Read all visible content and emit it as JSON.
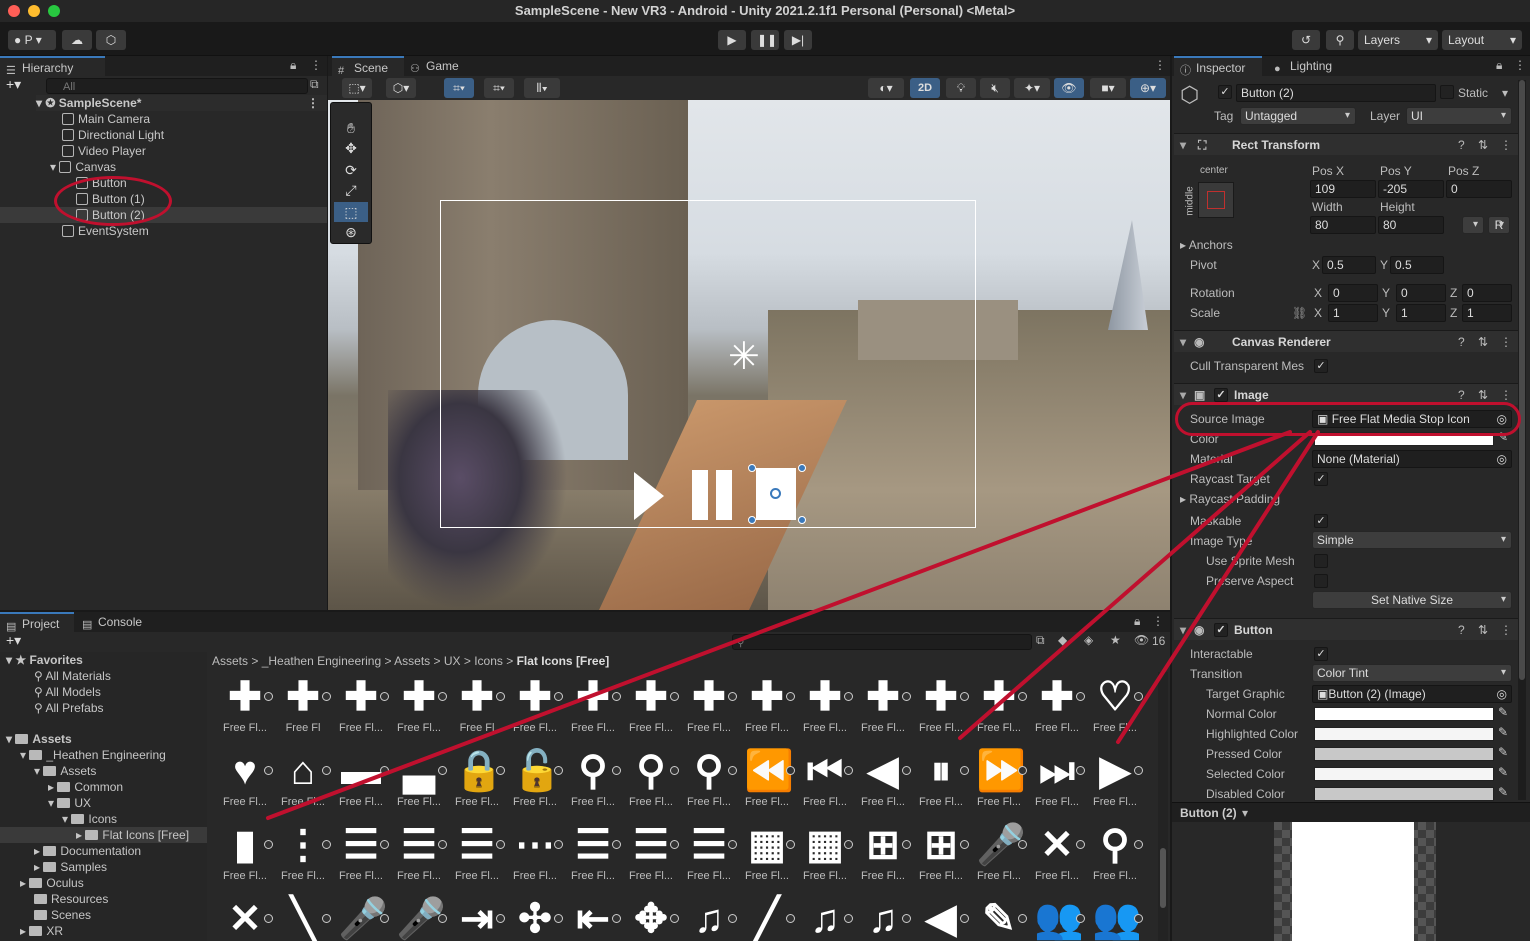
{
  "window": {
    "title": "SampleScene - New VR3 - Android - Unity 2021.2.1f1 Personal (Personal) <Metal>"
  },
  "toolbar": {
    "account_label": "P",
    "layers_label": "Layers",
    "layout_label": "Layout"
  },
  "hierarchy": {
    "tab_label": "Hierarchy",
    "search_placeholder": "All",
    "scene_name": "SampleScene*",
    "items": [
      {
        "label": "Main Camera"
      },
      {
        "label": "Directional Light"
      },
      {
        "label": "Video Player"
      },
      {
        "label": "Canvas"
      },
      {
        "label": "Button"
      },
      {
        "label": "Button (1)"
      },
      {
        "label": "Button (2)"
      },
      {
        "label": "EventSystem"
      }
    ]
  },
  "scene": {
    "tabs": [
      {
        "label": "Scene"
      },
      {
        "label": "Game"
      }
    ],
    "mode_2d": "2D"
  },
  "inspector": {
    "tabs": [
      {
        "label": "Inspector"
      },
      {
        "label": "Lighting"
      }
    ],
    "object_name": "Button (2)",
    "static_label": "Static",
    "tag_label": "Tag",
    "tag_value": "Untagged",
    "layer_label": "Layer",
    "layer_value": "UI",
    "rect_transform": {
      "title": "Rect Transform",
      "anchor_h": "center",
      "anchor_v": "middle",
      "pos_x_label": "Pos X",
      "pos_x": "109",
      "pos_y_label": "Pos Y",
      "pos_y": "-205",
      "pos_z_label": "Pos Z",
      "pos_z": "0",
      "width_label": "Width",
      "width": "80",
      "height_label": "Height",
      "height": "80",
      "r_button": "R",
      "anchors_label": "Anchors",
      "pivot_label": "Pivot",
      "pivot_x": "0.5",
      "pivot_y": "0.5",
      "rotation_label": "Rotation",
      "rot_x": "0",
      "rot_y": "0",
      "rot_z": "0",
      "scale_label": "Scale",
      "scale_x": "1",
      "scale_y": "1",
      "scale_z": "1",
      "x": "X",
      "y": "Y",
      "z": "Z"
    },
    "canvas_renderer": {
      "title": "Canvas Renderer",
      "cull_label": "Cull Transparent Mes"
    },
    "image": {
      "title": "Image",
      "source_label": "Source Image",
      "source_value": "Free Flat Media Stop Icon",
      "color_label": "Color",
      "material_label": "Material",
      "material_value": "None (Material)",
      "raycast_label": "Raycast Target",
      "raycast_padding_label": "Raycast Padding",
      "maskable_label": "Maskable",
      "image_type_label": "Image Type",
      "image_type_value": "Simple",
      "use_sprite_mesh_label": "Use Sprite Mesh",
      "preserve_aspect_label": "Preserve Aspect",
      "native_size_label": "Set Native Size"
    },
    "button": {
      "title": "Button",
      "interactable_label": "Interactable",
      "transition_label": "Transition",
      "transition_value": "Color Tint",
      "target_graphic_label": "Target Graphic",
      "target_graphic_value": "Button (2) (Image)",
      "normal_label": "Normal Color",
      "highlighted_label": "Highlighted Color",
      "pressed_label": "Pressed Color",
      "selected_label": "Selected Color",
      "disabled_label": "Disabled Color"
    },
    "preview_label": "Button (2)"
  },
  "project": {
    "tabs": [
      {
        "label": "Project"
      },
      {
        "label": "Console"
      }
    ],
    "visible_count": "16",
    "favorites_label": "Favorites",
    "favorites": [
      {
        "label": "All Materials"
      },
      {
        "label": "All Models"
      },
      {
        "label": "All Prefabs"
      }
    ],
    "tree": [
      {
        "label": "Assets"
      },
      {
        "label": "_Heathen Engineering"
      },
      {
        "label": "Assets"
      },
      {
        "label": "Common"
      },
      {
        "label": "UX"
      },
      {
        "label": "Icons"
      },
      {
        "label": "Flat Icons [Free]"
      },
      {
        "label": "Documentation"
      },
      {
        "label": "Samples"
      },
      {
        "label": "Oculus"
      },
      {
        "label": "Resources"
      },
      {
        "label": "Scenes"
      },
      {
        "label": "XR"
      }
    ],
    "breadcrumb": [
      {
        "label": "Assets"
      },
      {
        "label": "_Heathen Engineering"
      },
      {
        "label": "Assets"
      },
      {
        "label": "UX"
      },
      {
        "label": "Icons"
      },
      {
        "label": "Flat Icons [Free]"
      }
    ],
    "asset_label": "Free Fl...",
    "asset_label_b": "Free Fl",
    "rows": [
      [
        "✚",
        "✚",
        "✚",
        "✚",
        "✚",
        "✚",
        "✚",
        "✚",
        "✚",
        "✚",
        "✚",
        "✚",
        "✚",
        "✚",
        "✚",
        "♡"
      ],
      [
        "♥",
        "⌂",
        "▬",
        "▃",
        "🔒",
        "🔓",
        "⚲",
        "⚲",
        "⚲",
        "⏪",
        "⏮",
        "◀",
        "⏸",
        "⏩",
        "⏭",
        "▶"
      ],
      [
        "▮",
        "⋮",
        "☰",
        "☰",
        "☰",
        "⋯",
        "☰",
        "☰",
        "☰",
        "▦",
        "▦",
        "⊞",
        "⊞",
        "🎤",
        "✕",
        "⚲"
      ],
      [
        "✕",
        "╲",
        "🎤",
        "🎤",
        "⇥",
        "✣",
        "⇤",
        "✥",
        "♫",
        "╱",
        "♫",
        "♫",
        "◀",
        "✎",
        "👥",
        "👥"
      ]
    ]
  },
  "colors": {
    "accent": "#3a79bb",
    "annotation": "#c0102e",
    "panel": "#282828"
  }
}
